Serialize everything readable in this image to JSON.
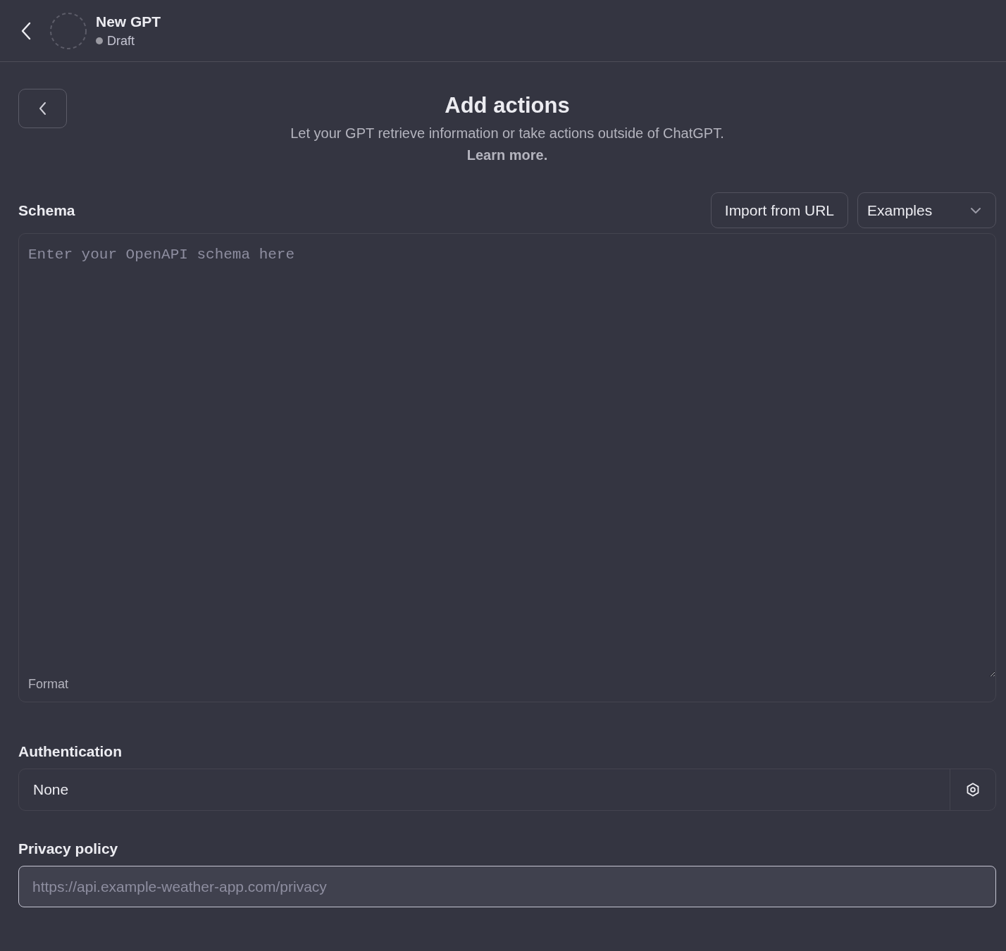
{
  "header": {
    "title": "New GPT",
    "status": "Draft"
  },
  "intro": {
    "title": "Add actions",
    "description": "Let your GPT retrieve information or take actions outside of ChatGPT.",
    "link": "Learn more."
  },
  "schema": {
    "label": "Schema",
    "import_button": "Import from URL",
    "examples": "Examples",
    "placeholder": "Enter your OpenAPI schema here",
    "format_label": "Format"
  },
  "authentication": {
    "label": "Authentication",
    "value": "None"
  },
  "privacy_policy": {
    "label": "Privacy policy",
    "placeholder": "https://api.example-weather-app.com/privacy"
  }
}
